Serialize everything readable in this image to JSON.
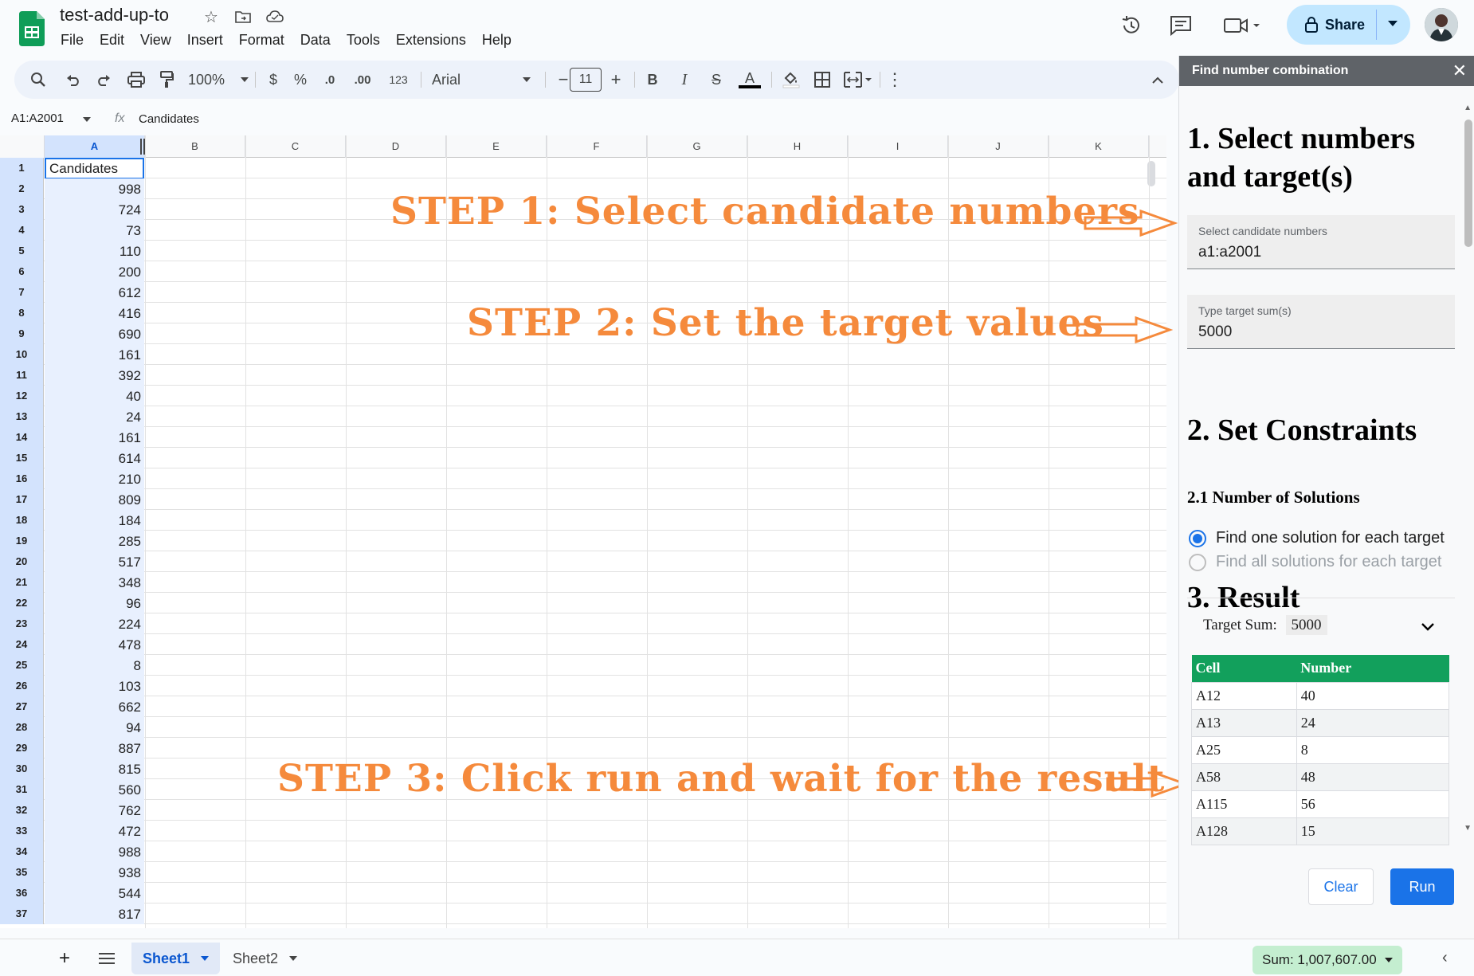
{
  "doc": {
    "title": "test-add-up-to"
  },
  "menu": [
    "File",
    "Edit",
    "View",
    "Insert",
    "Format",
    "Data",
    "Tools",
    "Extensions",
    "Help"
  ],
  "header": {
    "share_label": "Share"
  },
  "toolbar": {
    "zoom": "100%",
    "currency": "$",
    "percent": "%",
    "dec_decrease": ".0",
    "dec_increase": ".00",
    "number_format": "123",
    "font": "Arial",
    "font_size": "11",
    "bold": "B",
    "italic": "I",
    "strike": "S",
    "text_color": "A",
    "minus": "−",
    "plus": "+"
  },
  "formula_bar": {
    "name_box": "A1:A2001",
    "fx": "fx",
    "content": "Candidates"
  },
  "columns": [
    "A",
    "B",
    "C",
    "D",
    "E",
    "F",
    "G",
    "H",
    "I",
    "J",
    "K"
  ],
  "rows": [
    {
      "n": "1",
      "a": "Candidates"
    },
    {
      "n": "2",
      "a": "998"
    },
    {
      "n": "3",
      "a": "724"
    },
    {
      "n": "4",
      "a": "73"
    },
    {
      "n": "5",
      "a": "110"
    },
    {
      "n": "6",
      "a": "200"
    },
    {
      "n": "7",
      "a": "612"
    },
    {
      "n": "8",
      "a": "416"
    },
    {
      "n": "9",
      "a": "690"
    },
    {
      "n": "10",
      "a": "161"
    },
    {
      "n": "11",
      "a": "392"
    },
    {
      "n": "12",
      "a": "40"
    },
    {
      "n": "13",
      "a": "24"
    },
    {
      "n": "14",
      "a": "161"
    },
    {
      "n": "15",
      "a": "614"
    },
    {
      "n": "16",
      "a": "210"
    },
    {
      "n": "17",
      "a": "809"
    },
    {
      "n": "18",
      "a": "184"
    },
    {
      "n": "19",
      "a": "285"
    },
    {
      "n": "20",
      "a": "517"
    },
    {
      "n": "21",
      "a": "348"
    },
    {
      "n": "22",
      "a": "96"
    },
    {
      "n": "23",
      "a": "224"
    },
    {
      "n": "24",
      "a": "478"
    },
    {
      "n": "25",
      "a": "8"
    },
    {
      "n": "26",
      "a": "103"
    },
    {
      "n": "27",
      "a": "662"
    },
    {
      "n": "28",
      "a": "94"
    },
    {
      "n": "29",
      "a": "887"
    },
    {
      "n": "30",
      "a": "815"
    },
    {
      "n": "31",
      "a": "560"
    },
    {
      "n": "32",
      "a": "762"
    },
    {
      "n": "33",
      "a": "472"
    },
    {
      "n": "34",
      "a": "988"
    },
    {
      "n": "35",
      "a": "938"
    },
    {
      "n": "36",
      "a": "544"
    },
    {
      "n": "37",
      "a": "817"
    }
  ],
  "annotations": {
    "step1": "STEP 1: Select candidate numbers",
    "step2": "STEP 2: Set the target values",
    "step3": "STEP 3: Click run and wait for the result"
  },
  "sidebar": {
    "title": "Find number combination",
    "h1": "1. Select numbers and target(s)",
    "candidates_label": "Select candidate numbers",
    "candidates_value": "a1:a2001",
    "target_label": "Type target sum(s)",
    "target_value": "5000",
    "h2": "2. Set Constraints",
    "h2_1": "2.1 Number of Solutions",
    "radio_one": "Find one solution for each target",
    "radio_all": "Find all solutions for each target",
    "h3": "3. Result",
    "target_sum_label": "Target Sum:",
    "target_sum_value": "5000",
    "table_headers": [
      "Cell",
      "Number"
    ],
    "results": [
      {
        "cell": "A12",
        "number": "40"
      },
      {
        "cell": "A13",
        "number": "24"
      },
      {
        "cell": "A25",
        "number": "8"
      },
      {
        "cell": "A58",
        "number": "48"
      },
      {
        "cell": "A115",
        "number": "56"
      },
      {
        "cell": "A128",
        "number": "15"
      }
    ],
    "clear_label": "Clear",
    "run_label": "Run"
  },
  "footer": {
    "sheets": [
      "Sheet1",
      "Sheet2"
    ],
    "sum": "Sum: 1,007,607.00"
  },
  "colors": {
    "accent": "#1a73e8",
    "annotation": "#f58a3c",
    "table_header": "#12a05c",
    "share": "#c2e7ff"
  }
}
